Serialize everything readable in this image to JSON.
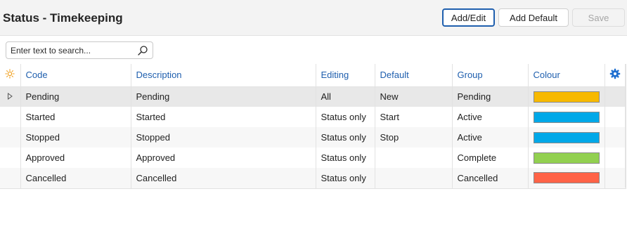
{
  "page": {
    "title": "Status - Timekeeping"
  },
  "toolbar": {
    "add_edit_label": "Add/Edit",
    "add_default_label": "Add Default",
    "save_label": "Save"
  },
  "search": {
    "placeholder": "Enter text to search...",
    "icon": "search-icon"
  },
  "grid": {
    "header_icon": "sun-icon",
    "settings_icon": "gear-icon",
    "columns": [
      "Code",
      "Description",
      "Editing",
      "Default",
      "Group",
      "Colour"
    ],
    "rows": [
      {
        "code": "Pending",
        "description": "Pending",
        "editing": "All",
        "default": "New",
        "group": "Pending",
        "colour": "#f7b900",
        "selected": true
      },
      {
        "code": "Started",
        "description": "Started",
        "editing": "Status only",
        "default": "Start",
        "group": "Active",
        "colour": "#00a8e8",
        "selected": false
      },
      {
        "code": "Stopped",
        "description": "Stopped",
        "editing": "Status only",
        "default": "Stop",
        "group": "Active",
        "colour": "#00a8e8",
        "selected": false
      },
      {
        "code": "Approved",
        "description": "Approved",
        "editing": "Status only",
        "default": "",
        "group": "Complete",
        "colour": "#92d050",
        "selected": false
      },
      {
        "code": "Cancelled",
        "description": "Cancelled",
        "editing": "Status only",
        "default": "",
        "group": "Cancelled",
        "colour": "#ff6347",
        "selected": false
      }
    ]
  },
  "colors": {
    "accent": "#1f5fae",
    "header_text": "#1f5fae",
    "sun_icon": "#f0a020",
    "gear_icon": "#1f6fd0"
  }
}
